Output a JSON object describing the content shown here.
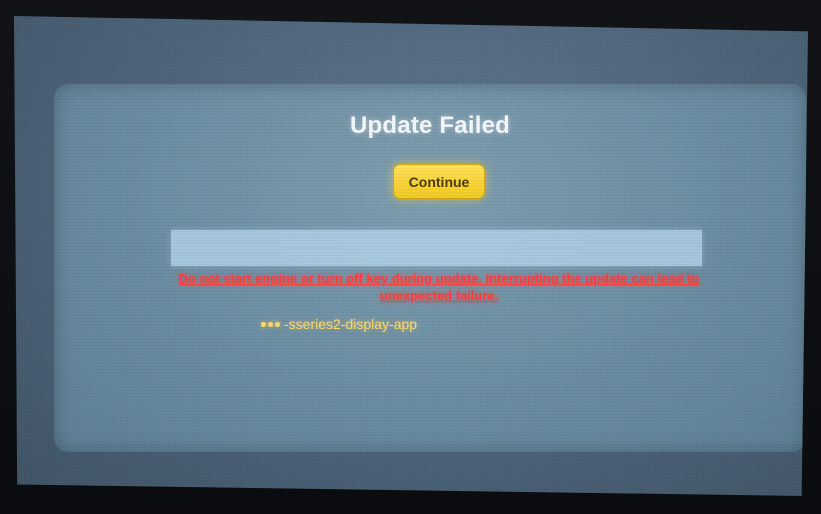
{
  "dialog": {
    "title": "Update Failed",
    "continue_label": "Continue",
    "progress": 1.0,
    "warning": "Do not start engine or turn off key during update. Interrupting the update can lead to unexpected failure.",
    "app_name": "-sseries2-display-app",
    "status_icon": "dots-icon"
  },
  "colors": {
    "warning_text": "#ff3b3b",
    "button_bg": "#f2c91c",
    "app_text": "#ffd86a",
    "dialog_bg": "#6c8ea2"
  }
}
